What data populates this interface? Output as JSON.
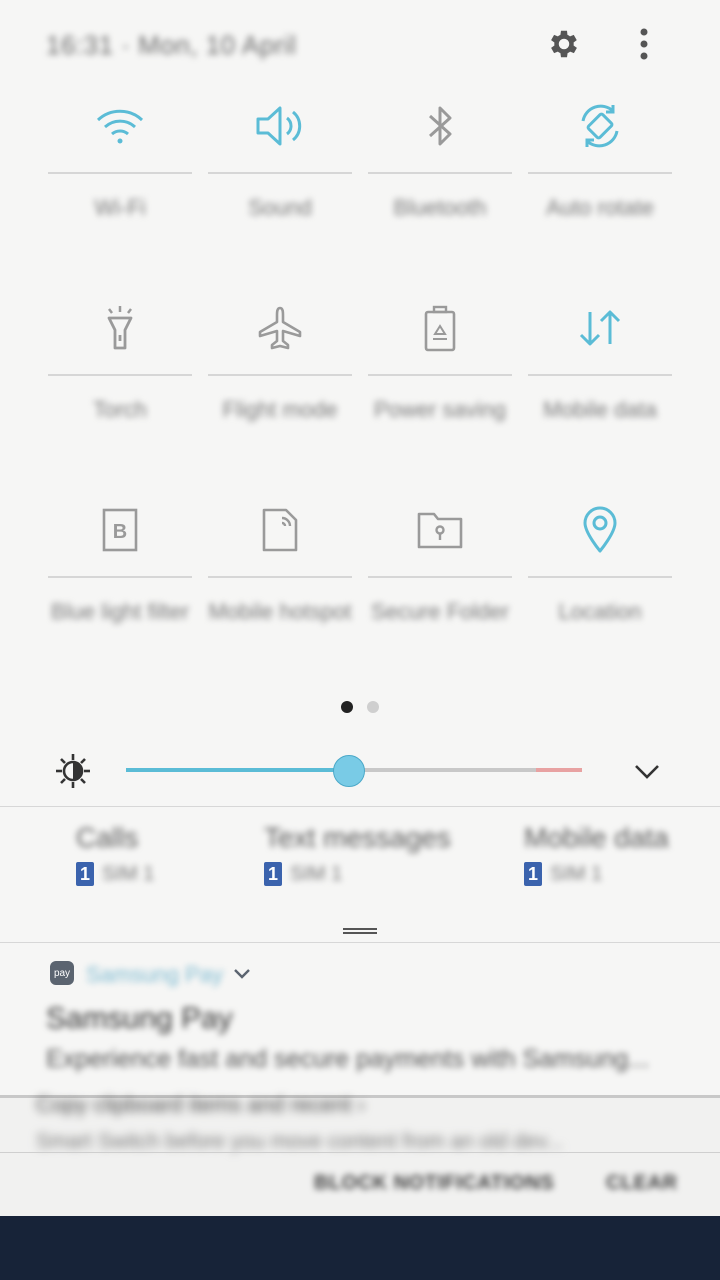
{
  "header": {
    "datetime": "16:31 · Mon, 10 April",
    "settings_icon": "gear-icon",
    "more_icon": "more-vert-icon"
  },
  "tiles": [
    {
      "label": "Wi-Fi",
      "icon": "wifi-icon",
      "active": true
    },
    {
      "label": "Sound",
      "icon": "volume-icon",
      "active": true
    },
    {
      "label": "Bluetooth",
      "icon": "bluetooth-icon",
      "active": false
    },
    {
      "label": "Auto rotate",
      "icon": "auto-rotate-icon",
      "active": true
    },
    {
      "label": "Torch",
      "icon": "torch-icon",
      "active": false
    },
    {
      "label": "Flight mode",
      "icon": "airplane-icon",
      "active": false
    },
    {
      "label": "Power saving",
      "icon": "battery-recycle-icon",
      "active": false
    },
    {
      "label": "Mobile data",
      "icon": "data-arrows-icon",
      "active": true
    },
    {
      "label": "Blue light filter",
      "icon": "blue-light-filter-icon",
      "active": false
    },
    {
      "label": "Mobile hotspot",
      "icon": "hotspot-icon",
      "active": false
    },
    {
      "label": "Secure Folder",
      "icon": "secure-folder-icon",
      "active": false
    },
    {
      "label": "Location",
      "icon": "location-pin-icon",
      "active": true
    }
  ],
  "pager": {
    "current": 1,
    "total": 2
  },
  "brightness": {
    "level": 0.49,
    "icon": "brightness-icon",
    "expand_icon": "chevron-down-icon"
  },
  "sim": [
    {
      "title": "Calls",
      "sim_number": "1",
      "sim_name": "SIM 1"
    },
    {
      "title": "Text messages",
      "sim_number": "1",
      "sim_name": "SIM 1"
    },
    {
      "title": "Mobile data",
      "sim_number": "1",
      "sim_name": "SIM 1"
    }
  ],
  "notification": {
    "app_icon_text": "pay",
    "app_name": "Samsung Pay",
    "title": "Samsung Pay",
    "text": "Experience fast and secure payments with Samsung..."
  },
  "second_notification": {
    "title": "Copy clipboard items and recent ›",
    "text": "Smart Switch before you move content from an old dev..."
  },
  "actions": {
    "block": "BLOCK NOTIFICATIONS",
    "clear": "CLEAR"
  },
  "colors": {
    "accent": "#5bbcd6",
    "inactive_icon": "#9a9a9a",
    "navbar": "#172338"
  }
}
